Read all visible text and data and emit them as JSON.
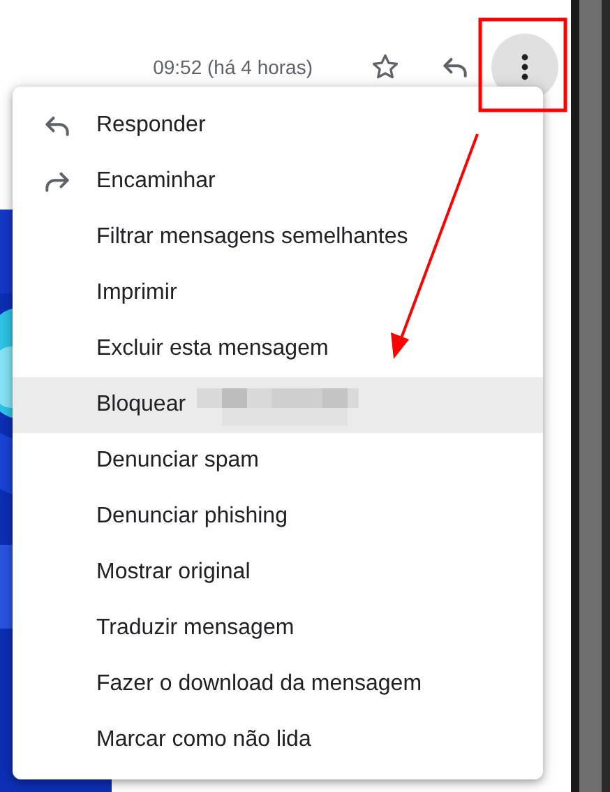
{
  "header": {
    "timestamp": "09:52 (há 4 horas)"
  },
  "menu": {
    "items": [
      {
        "label": "Responder",
        "kind": "reply",
        "selected": false
      },
      {
        "label": "Encaminhar",
        "kind": "forward",
        "selected": false
      },
      {
        "label": "Filtrar mensagens semelhantes",
        "kind": "plain",
        "selected": false
      },
      {
        "label": "Imprimir",
        "kind": "plain",
        "selected": false
      },
      {
        "label": "Excluir esta mensagem",
        "kind": "plain",
        "selected": false
      },
      {
        "label": "Bloquear",
        "kind": "redacted",
        "selected": true
      },
      {
        "label": "Denunciar spam",
        "kind": "plain",
        "selected": false
      },
      {
        "label": "Denunciar phishing",
        "kind": "plain",
        "selected": false
      },
      {
        "label": "Mostrar original",
        "kind": "plain",
        "selected": false
      },
      {
        "label": "Traduzir mensagem",
        "kind": "plain",
        "selected": false
      },
      {
        "label": "Fazer o download da mensagem",
        "kind": "plain",
        "selected": false
      },
      {
        "label": "Marcar como não lida",
        "kind": "plain",
        "selected": false
      }
    ]
  }
}
